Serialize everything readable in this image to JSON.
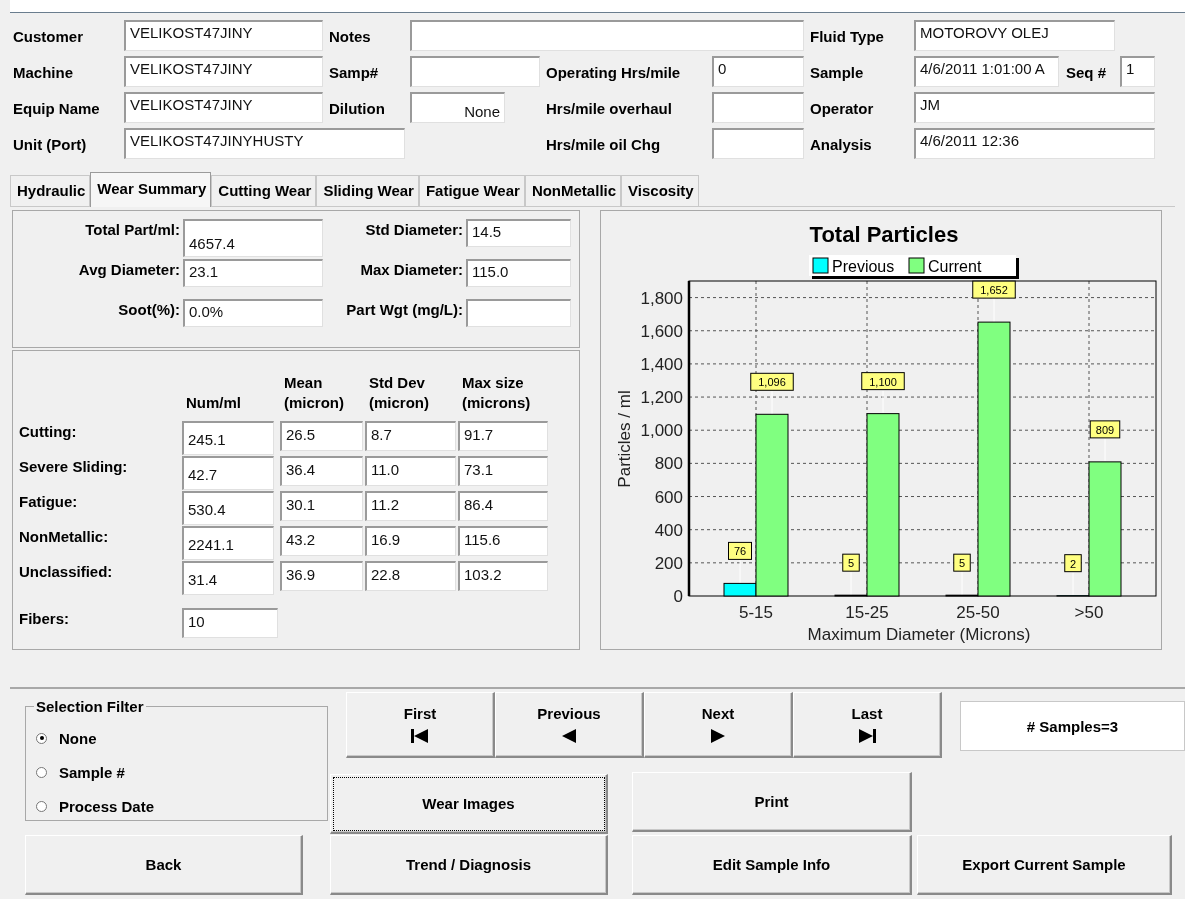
{
  "header": {
    "fields": [
      {
        "label": "Customer",
        "value": "VELIKOST47JINY"
      },
      {
        "label": "Notes"
      },
      {
        "label": "Fluid Type",
        "value": "MOTOROVY OLEJ"
      },
      {
        "label": "Machine",
        "value": "VELIKOST47JINY"
      },
      {
        "label": "Samp#"
      },
      {
        "label": "Operating Hrs/mile",
        "value": "0"
      },
      {
        "label": "Sample",
        "value": "4/6/2011 1:01:00 A"
      },
      {
        "label": "Seq #",
        "value": "1"
      },
      {
        "label": "Equip Name",
        "value": "VELIKOST47JINY"
      },
      {
        "label": "Dilution",
        "value": "None"
      },
      {
        "label": "Hrs/mile overhaul"
      },
      {
        "label": "Operator",
        "value": "JM"
      },
      {
        "label": "Unit (Port)",
        "value": "VELIKOST47JINYHUSTY"
      },
      {
        "label": "Hrs/mile oil Chg"
      },
      {
        "label": "Analysis",
        "value": "4/6/2011 12:36"
      }
    ]
  },
  "tabs": [
    {
      "label": "Hydraulic",
      "selected": false
    },
    {
      "label": "Wear Summary",
      "selected": true
    },
    {
      "label": "Cutting Wear",
      "selected": false
    },
    {
      "label": "Sliding Wear",
      "selected": false
    },
    {
      "label": "Fatigue Wear",
      "selected": false
    },
    {
      "label": "NonMetallic",
      "selected": false
    },
    {
      "label": "Viscosity",
      "selected": false
    }
  ],
  "summary": {
    "fields": [
      {
        "label": "Total Part/ml:",
        "value": "4657.4"
      },
      {
        "label": "Std Diameter:",
        "value": "14.5"
      },
      {
        "label": "Avg Diameter:",
        "value": "23.1"
      },
      {
        "label": "Max Diameter:",
        "value": "115.0"
      },
      {
        "label": "Soot(%):",
        "value": "0.0%"
      },
      {
        "label": "Part Wgt (mg/L):"
      }
    ]
  },
  "wear_table": {
    "columns": [
      "Num/ml",
      "Mean (micron)",
      "Std Dev (micron)",
      "Max size (microns)"
    ],
    "rows": [
      {
        "label": "Cutting:",
        "values": [
          "245.1",
          "26.5",
          "8.7",
          "91.7"
        ]
      },
      {
        "label": "Severe Sliding:",
        "values": [
          "42.7",
          "36.4",
          "11.0",
          "73.1"
        ]
      },
      {
        "label": "Fatigue:",
        "values": [
          "530.4",
          "30.1",
          "11.2",
          "86.4"
        ]
      },
      {
        "label": "NonMetallic:",
        "values": [
          "2241.1",
          "43.2",
          "16.9",
          "115.6"
        ]
      },
      {
        "label": "Unclassified:",
        "values": [
          "31.4",
          "36.9",
          "22.8",
          "103.2"
        ]
      }
    ],
    "fibers": {
      "label": "Fibers:",
      "value": "10"
    }
  },
  "chart": {
    "chart_data": {
      "type": "bar",
      "title": "Total Particles",
      "xlabel": "Maximum Diameter (Microns)",
      "ylabel": "Particles / ml",
      "categories": [
        "5-15",
        "15-25",
        "25-50",
        ">50"
      ],
      "series": [
        {
          "name": "Previous",
          "color": "#00ffff",
          "values": [
            76,
            5,
            5,
            2
          ],
          "value_labels": [
            "76",
            "5",
            "5",
            "2"
          ]
        },
        {
          "name": "Current",
          "color": "#80ff80",
          "values": [
            1096,
            1100,
            1652,
            809
          ],
          "value_labels": [
            "1,096",
            "1,100",
            "1,652",
            "809"
          ]
        }
      ],
      "legend": true,
      "grid": true,
      "ylim": [
        0,
        1900
      ],
      "yticks": [
        {
          "value": 0,
          "label": "0"
        },
        {
          "value": 200,
          "label": "200"
        },
        {
          "value": 400,
          "label": "400"
        },
        {
          "value": 600,
          "label": "600"
        },
        {
          "value": 800,
          "label": "800"
        },
        {
          "value": 1000,
          "label": "1,000"
        },
        {
          "value": 1200,
          "label": "1,200"
        },
        {
          "value": 1400,
          "label": "1,400"
        },
        {
          "value": 1600,
          "label": "1,600"
        },
        {
          "value": 1800,
          "label": "1,800"
        }
      ],
      "data_labels": true
    }
  },
  "selection_filter": {
    "title": "Selection Filter",
    "options": [
      {
        "label": "None",
        "selected": true
      },
      {
        "label": "Sample #",
        "selected": false
      },
      {
        "label": "Process Date",
        "selected": false
      }
    ]
  },
  "navigation": [
    {
      "label": "First"
    },
    {
      "label": "Previous"
    },
    {
      "label": "Next"
    },
    {
      "label": "Last"
    }
  ],
  "sample_count": "# Samples=3",
  "buttons": {
    "wear_images": "Wear Images",
    "print": "Print",
    "back": "Back",
    "trend": "Trend / Diagnosis",
    "edit": "Edit Sample Info",
    "export": "Export Current Sample"
  }
}
